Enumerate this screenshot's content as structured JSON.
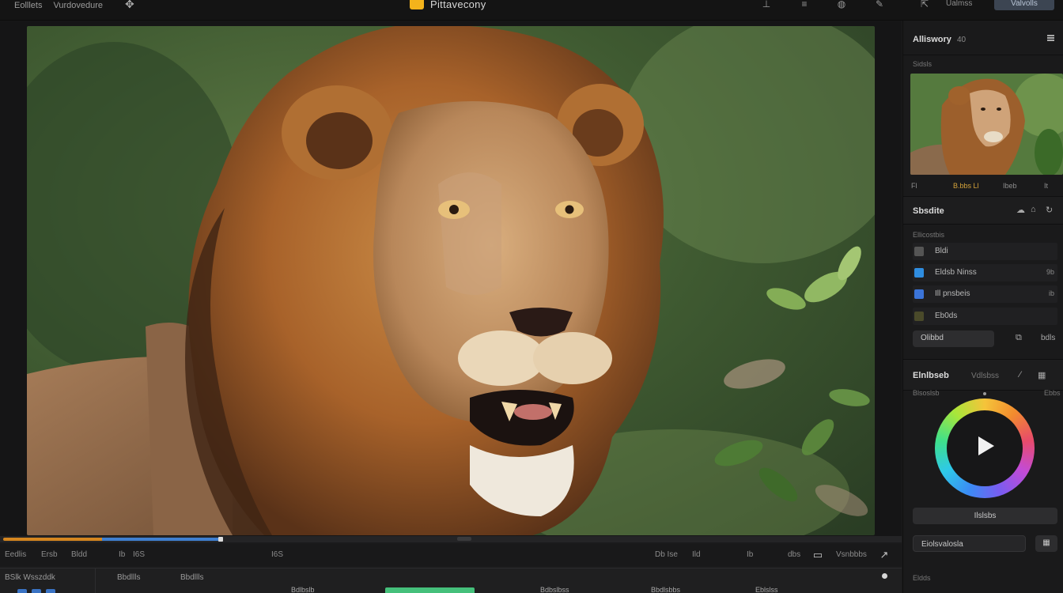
{
  "app": {
    "title": "Pittavecony",
    "menu": [
      "Eolllets",
      "Vurdovedure"
    ],
    "top_buttons": {
      "plain": "Ualmss",
      "primary": "Valvolls"
    }
  },
  "colors": {
    "accent_orange": "#d4861f",
    "accent_blue": "#3f7fd0",
    "clip_green": "#45c07b",
    "logo_yellow": "#f3b31b"
  },
  "icons": {
    "top": [
      "cursor-icon",
      "pin-icon",
      "list-icon",
      "globe-icon",
      "pen-icon",
      "export-icon"
    ],
    "controls": [
      "caption-icon",
      "share-icon"
    ]
  },
  "playback": {
    "progress_fraction": 0.2,
    "buffered_fraction": 0.2
  },
  "controls": {
    "left": [
      "Eedlis",
      "Ersb",
      "Bldd",
      "Ib",
      "I6S",
      "I6S"
    ],
    "right": [
      "Db Ise",
      "Ild",
      "Ib",
      "dbs",
      "Vsnbbbs"
    ]
  },
  "timeline": {
    "track_label": "BSlk Wsszddk",
    "headers": [
      "Bbdllls",
      "Bbdllls"
    ],
    "markers": [
      "Bdlbslb",
      "Bdbslbss",
      "Bbdlsbbs",
      "Eblslss"
    ]
  },
  "panel": {
    "adjust": {
      "title": "Alliswory",
      "count": "40",
      "subtitle": "Sidsls"
    },
    "thumb_meta": {
      "left": "Fl",
      "mid": "B.bbs Ll",
      "right": "Ibeb",
      "far": "It"
    },
    "selection": {
      "title": "Sbsdite",
      "subtitle": "Ellicostbis",
      "rows": [
        {
          "label": "Bldi",
          "value": "",
          "color": "#555555"
        },
        {
          "label": "Eldsb Ninss",
          "value": "9b",
          "color": "#2f8de0"
        },
        {
          "label": "Ill pnsbeis",
          "value": "ib",
          "color": "#3b74d8"
        },
        {
          "label": "Eb0ds",
          "value": "",
          "color": "#4a4a2a"
        }
      ],
      "pill": "Olibbd",
      "right": "bdls"
    },
    "color": {
      "title": "Elnlbseb",
      "tab": "Vdlsbss",
      "sub_left": "Blsoslsb",
      "sub_right": "Ebbs",
      "button_wide": "Ilslsbs",
      "input": "Eiolsvalosla",
      "bottom_label": "Eldds"
    }
  }
}
